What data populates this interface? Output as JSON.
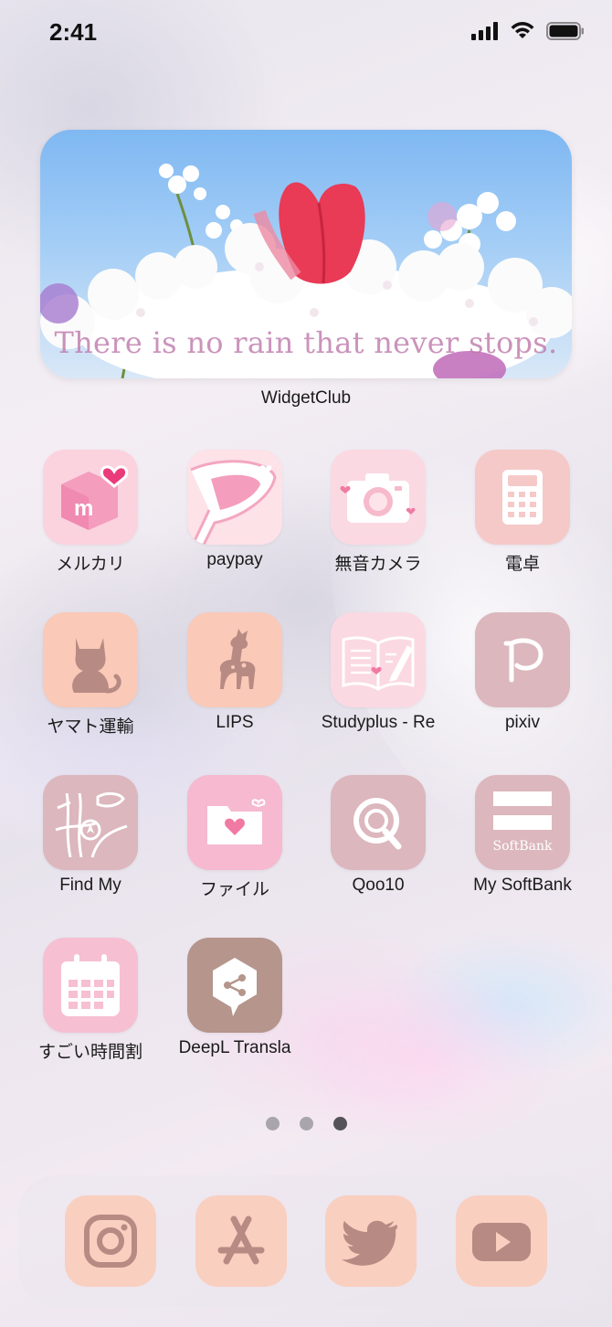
{
  "status_bar": {
    "time": "2:41",
    "icons": [
      "cellular-signal-icon",
      "wifi-icon",
      "battery-icon"
    ]
  },
  "widget": {
    "quote": "There is no rain that never stops.",
    "label": "WidgetClub"
  },
  "apps": [
    {
      "label": "メルカリ",
      "icon": "mercari-icon",
      "bg": "#fbd3df"
    },
    {
      "label": "paypay",
      "icon": "paypay-icon",
      "bg": "#fcd6df"
    },
    {
      "label": "無音カメラ",
      "icon": "camera-icon",
      "bg": "#fbd9e2"
    },
    {
      "label": "電卓",
      "icon": "calculator-icon",
      "bg": "#f6c9c9"
    },
    {
      "label": "ヤマト運輸",
      "icon": "cat-icon",
      "bg": "#fac9b7"
    },
    {
      "label": "LIPS",
      "icon": "fawn-icon",
      "bg": "#fac9b7"
    },
    {
      "label": "Studyplus - Re",
      "icon": "open-book-icon",
      "bg": "#fbd9e2"
    },
    {
      "label": "pixiv",
      "icon": "pixiv-icon",
      "bg": "#dcb7bd"
    },
    {
      "label": "Find My",
      "icon": "map-icon",
      "bg": "#dcb7bd"
    },
    {
      "label": "ファイル",
      "icon": "folder-heart-icon",
      "bg": "#f6b9cf"
    },
    {
      "label": "Qoo10",
      "icon": "qoo10-icon",
      "bg": "#dcb7bd"
    },
    {
      "label": "My SoftBank",
      "icon": "softbank-icon",
      "bg": "#dcb7bd",
      "icon_text": "SoftBank"
    },
    {
      "label": "すごい時間割",
      "icon": "calendar-icon",
      "bg": "#f6bfd2"
    },
    {
      "label": "DeepL Transla",
      "icon": "deepl-icon",
      "bg": "#b5958c"
    }
  ],
  "page_indicator": {
    "count": 3,
    "active_index": 2
  },
  "dock": [
    {
      "icon": "instagram-icon"
    },
    {
      "icon": "app-store-icon"
    },
    {
      "icon": "twitter-icon"
    },
    {
      "icon": "youtube-icon"
    }
  ],
  "colors": {
    "icon_glyph": "#b78a83",
    "icon_white": "#ffffff",
    "dock_tile": "#f9cfc0"
  }
}
